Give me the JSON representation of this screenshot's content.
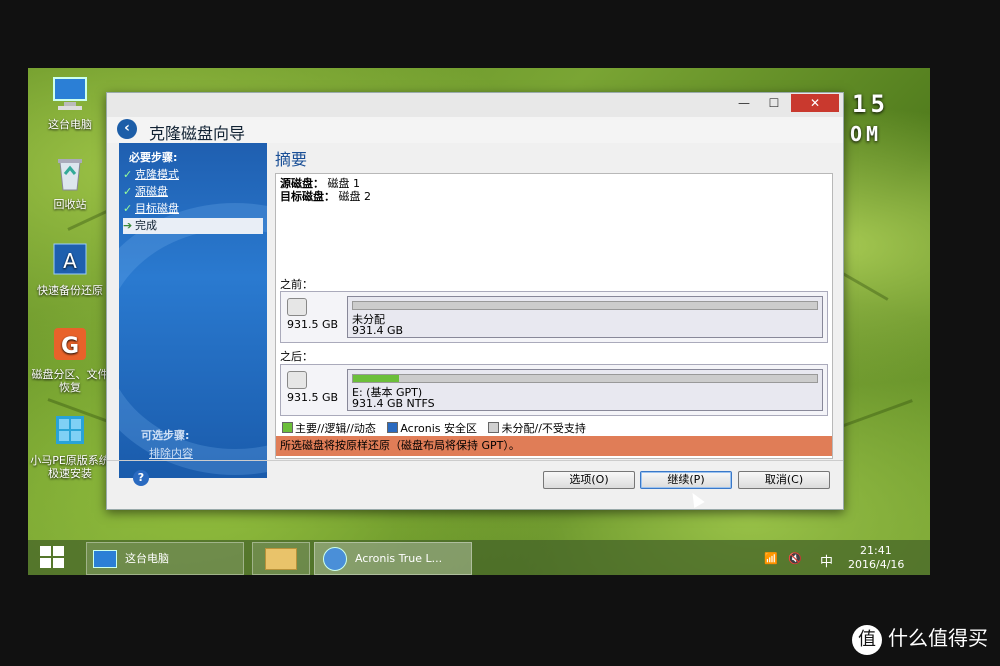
{
  "desktop": {
    "icons": [
      {
        "label": "这台电脑",
        "icon": "computer-icon"
      },
      {
        "label": "回收站",
        "icon": "recycle-bin-icon"
      },
      {
        "label": "快速备份还原",
        "icon": "backup-app-icon"
      },
      {
        "label": "磁盘分区、文件恢复",
        "icon": "partition-app-icon"
      },
      {
        "label": "小马PE原版系统极速安装",
        "icon": "installer-app-icon"
      }
    ],
    "clock_widget": {
      "line1": "15",
      "line2": "OM"
    }
  },
  "window": {
    "title": "克隆磁盘向导",
    "controls": {
      "minimize": "—",
      "maximize": "☐",
      "close": "✕"
    },
    "sidebar": {
      "required_heading": "必要步骤:",
      "steps": [
        {
          "label": "克隆模式",
          "done": true
        },
        {
          "label": "源磁盘",
          "done": true
        },
        {
          "label": "目标磁盘",
          "done": true
        },
        {
          "label": "完成",
          "done": false,
          "active": true
        }
      ],
      "optional_heading": "可选步骤:",
      "optional_link": "排除内容"
    },
    "main": {
      "title": "摘要",
      "source_label": "源磁盘：",
      "source_value": "磁盘 1",
      "target_label": "目标磁盘：",
      "target_value": "磁盘 2",
      "before": {
        "label": "之前：",
        "disk_size": "931.5 GB",
        "partition_name": "未分配",
        "partition_size": "931.4 GB",
        "fill_fraction": 0.0
      },
      "after": {
        "label": "之后：",
        "disk_size": "931.5 GB",
        "partition_name": "E: (基本 GPT)",
        "partition_size": "931.4 GB  NTFS",
        "fill_fraction": 0.1
      },
      "legend": [
        {
          "label": "主要//逻辑//动态",
          "color": "#6cbf3a"
        },
        {
          "label": "Acronis 安全区",
          "color": "#2a6ac0"
        },
        {
          "label": "未分配//不受支持",
          "color": "#d0d0d0"
        }
      ],
      "warning": "所选磁盘将按原样还原（磁盘布局将保持 GPT）。"
    },
    "buttons": {
      "options": "选项(O)",
      "continue": "继续(P)",
      "cancel": "取消(C)",
      "help": "?"
    }
  },
  "taskbar": {
    "items": [
      {
        "label": "这台电脑"
      },
      {
        "label": ""
      },
      {
        "label": "Acronis True L..."
      }
    ],
    "ime": "中",
    "time": "21:41",
    "date": "2016/4/16"
  },
  "watermark": {
    "icon": "值",
    "text": "什么值得买"
  }
}
